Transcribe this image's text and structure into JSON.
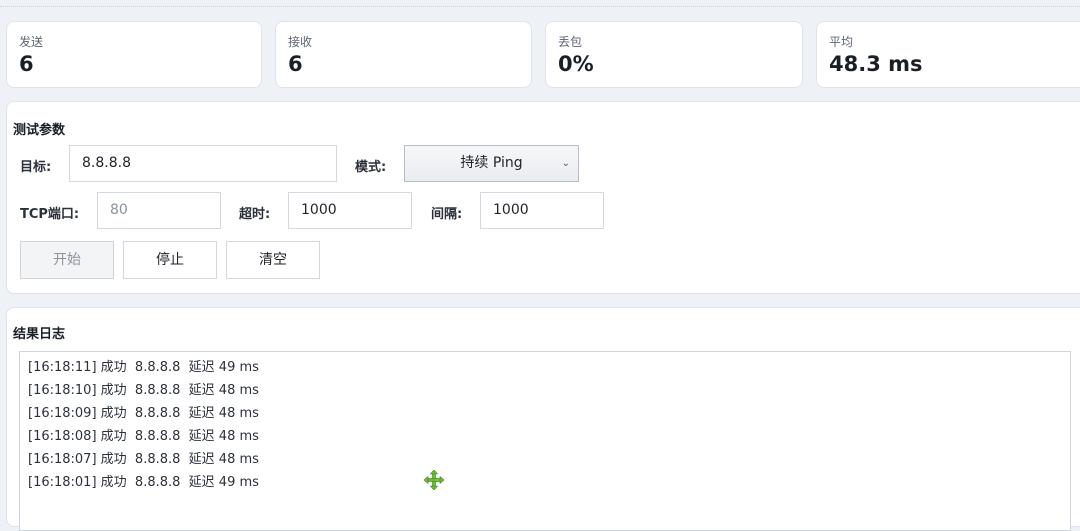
{
  "stats": [
    {
      "label": "发送",
      "value": "6"
    },
    {
      "label": "接收",
      "value": "6"
    },
    {
      "label": "丢包",
      "value": "0%"
    },
    {
      "label": "平均",
      "value": "48.3 ms"
    }
  ],
  "params": {
    "title": "测试参数",
    "target_label": "目标:",
    "target_value": "8.8.8.8",
    "mode_label": "模式:",
    "mode_value": "持续 Ping",
    "tcp_port_label": "TCP端口:",
    "tcp_port_value": "80",
    "timeout_label": "超时:",
    "timeout_value": "1000",
    "interval_label": "间隔:",
    "interval_value": "1000",
    "buttons": {
      "start": "开始",
      "stop": "停止",
      "clear": "清空"
    }
  },
  "log": {
    "title": "结果日志",
    "lines": [
      "[16:18:11] 成功  8.8.8.8  延迟 49 ms",
      "[16:18:10] 成功  8.8.8.8  延迟 48 ms",
      "[16:18:09] 成功  8.8.8.8  延迟 48 ms",
      "[16:18:08] 成功  8.8.8.8  延迟 48 ms",
      "[16:18:07] 成功  8.8.8.8  延迟 48 ms",
      "[16:18:01] 成功  8.8.8.8  延迟 49 ms"
    ]
  },
  "colors": {
    "cursor": "#6fbf3a",
    "background": "#eef2f7"
  },
  "icons": {
    "cursor": "move-cursor-icon",
    "dropdown": "chevron-down-icon"
  }
}
